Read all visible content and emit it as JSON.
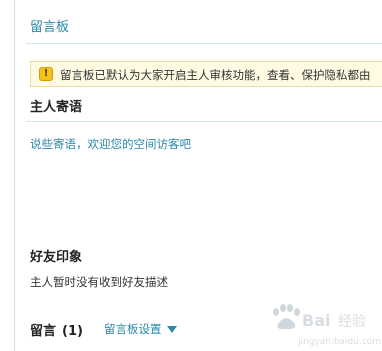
{
  "breadcrumb": {
    "label": "留言板"
  },
  "notice": {
    "icon": "warning-icon",
    "icon_glyph": "!",
    "text": "留言板已默认为大家开启主人审核功能，查看、保护隐私都由"
  },
  "host_section": {
    "title": "主人寄语",
    "message": "说些寄语，欢迎您的空间访客吧"
  },
  "impression_section": {
    "title": "好友印象",
    "text": "主人暂时没有收到好友描述"
  },
  "messages_section": {
    "title": "留言",
    "count": "(1)",
    "settings_label": "留言板设置"
  },
  "watermark": {
    "text": "Baidu 经验",
    "url": "jingyan.baidu.com"
  },
  "colors": {
    "link": "#2b88a8",
    "notice_bg": "#fffbe3",
    "notice_border": "#eadca4",
    "warning": "#f4c21c"
  }
}
